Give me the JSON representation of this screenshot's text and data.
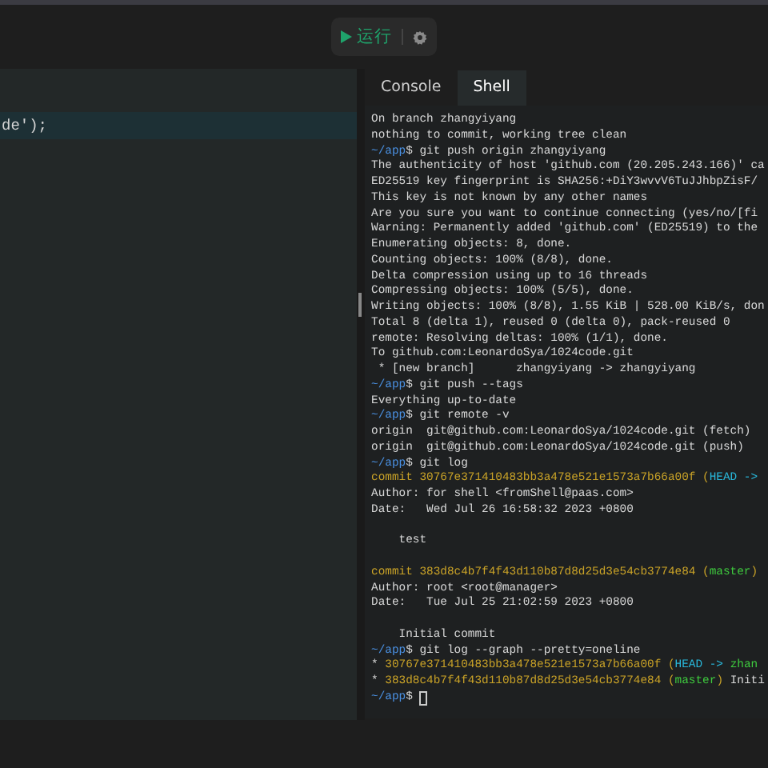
{
  "toolbar": {
    "run_button": {
      "label": "运行"
    }
  },
  "editor": {
    "code_line": {
      "text": "de');",
      "highlighted": true
    }
  },
  "terminal": {
    "tabs": [
      {
        "label": "Console",
        "selected": false
      },
      {
        "label": "Shell",
        "selected": true
      }
    ],
    "lines": [
      {
        "kind": "text",
        "segments": [
          {
            "kind": "plain",
            "text": "On branch zhangyiyang"
          }
        ]
      },
      {
        "kind": "text",
        "segments": [
          {
            "kind": "plain",
            "text": "nothing to commit, working tree clean"
          }
        ]
      },
      {
        "kind": "text",
        "segments": [
          {
            "kind": "prompt",
            "text": "~/app"
          },
          {
            "kind": "plain",
            "text": "$ git push origin zhangyiyang"
          }
        ]
      },
      {
        "kind": "text",
        "segments": [
          {
            "kind": "plain",
            "text": "The authenticity of host 'github.com (20.205.243.166)' ca"
          }
        ]
      },
      {
        "kind": "text",
        "segments": [
          {
            "kind": "plain",
            "text": "ED25519 key fingerprint is SHA256:+DiY3wvvV6TuJJhbpZisF/"
          }
        ]
      },
      {
        "kind": "text",
        "segments": [
          {
            "kind": "plain",
            "text": "This key is not known by any other names"
          }
        ]
      },
      {
        "kind": "text",
        "segments": [
          {
            "kind": "plain",
            "text": "Are you sure you want to continue connecting (yes/no/[fi"
          }
        ]
      },
      {
        "kind": "text",
        "segments": [
          {
            "kind": "plain",
            "text": "Warning: Permanently added 'github.com' (ED25519) to the"
          }
        ]
      },
      {
        "kind": "text",
        "segments": [
          {
            "kind": "plain",
            "text": "Enumerating objects: 8, done."
          }
        ]
      },
      {
        "kind": "text",
        "segments": [
          {
            "kind": "plain",
            "text": "Counting objects: 100% (8/8), done."
          }
        ]
      },
      {
        "kind": "text",
        "segments": [
          {
            "kind": "plain",
            "text": "Delta compression using up to 16 threads"
          }
        ]
      },
      {
        "kind": "text",
        "segments": [
          {
            "kind": "plain",
            "text": "Compressing objects: 100% (5/5), done."
          }
        ]
      },
      {
        "kind": "text",
        "segments": [
          {
            "kind": "plain",
            "text": "Writing objects: 100% (8/8), 1.55 KiB | 528.00 KiB/s, don"
          }
        ]
      },
      {
        "kind": "text",
        "segments": [
          {
            "kind": "plain",
            "text": "Total 8 (delta 1), reused 0 (delta 0), pack-reused 0"
          }
        ]
      },
      {
        "kind": "text",
        "segments": [
          {
            "kind": "plain",
            "text": "remote: Resolving deltas: 100% (1/1), done."
          }
        ]
      },
      {
        "kind": "text",
        "segments": [
          {
            "kind": "plain",
            "text": "To github.com:LeonardoSya/1024code.git"
          }
        ]
      },
      {
        "kind": "text",
        "segments": [
          {
            "kind": "plain",
            "text": " * [new branch]      zhangyiyang -> zhangyiyang"
          }
        ]
      },
      {
        "kind": "text",
        "segments": [
          {
            "kind": "prompt",
            "text": "~/app"
          },
          {
            "kind": "plain",
            "text": "$ git push --tags"
          }
        ]
      },
      {
        "kind": "text",
        "segments": [
          {
            "kind": "plain",
            "text": "Everything up-to-date"
          }
        ]
      },
      {
        "kind": "text",
        "segments": [
          {
            "kind": "prompt",
            "text": "~/app"
          },
          {
            "kind": "plain",
            "text": "$ git remote -v"
          }
        ]
      },
      {
        "kind": "text",
        "segments": [
          {
            "kind": "plain",
            "text": "origin  git@github.com:LeonardoSya/1024code.git (fetch)"
          }
        ]
      },
      {
        "kind": "text",
        "segments": [
          {
            "kind": "plain",
            "text": "origin  git@github.com:LeonardoSya/1024code.git (push)"
          }
        ]
      },
      {
        "kind": "text",
        "segments": [
          {
            "kind": "prompt",
            "text": "~/app"
          },
          {
            "kind": "plain",
            "text": "$ git log"
          }
        ]
      },
      {
        "kind": "text",
        "segments": [
          {
            "kind": "hash",
            "text": "commit 30767e371410483bb3a478e521e1573a7b66a00f ("
          },
          {
            "kind": "head",
            "text": "HEAD ->"
          }
        ]
      },
      {
        "kind": "text",
        "segments": [
          {
            "kind": "plain",
            "text": "Author: for shell <fromShell@paas.com>"
          }
        ]
      },
      {
        "kind": "text",
        "segments": [
          {
            "kind": "plain",
            "text": "Date:   Wed Jul 26 16:58:32 2023 +0800"
          }
        ]
      },
      {
        "kind": "blank"
      },
      {
        "kind": "text",
        "segments": [
          {
            "kind": "plain",
            "text": "    test"
          }
        ]
      },
      {
        "kind": "blank"
      },
      {
        "kind": "text",
        "segments": [
          {
            "kind": "hash",
            "text": "commit 383d8c4b7f4f43d110b87d8d25d3e54cb3774e84 ("
          },
          {
            "kind": "branch",
            "text": "master"
          },
          {
            "kind": "hash",
            "text": ")"
          }
        ]
      },
      {
        "kind": "text",
        "segments": [
          {
            "kind": "plain",
            "text": "Author: root <root@manager>"
          }
        ]
      },
      {
        "kind": "text",
        "segments": [
          {
            "kind": "plain",
            "text": "Date:   Tue Jul 25 21:02:59 2023 +0800"
          }
        ]
      },
      {
        "kind": "blank"
      },
      {
        "kind": "text",
        "segments": [
          {
            "kind": "plain",
            "text": "    Initial commit"
          }
        ]
      },
      {
        "kind": "text",
        "segments": [
          {
            "kind": "prompt",
            "text": "~/app"
          },
          {
            "kind": "plain",
            "text": "$ git log --graph --pretty=oneline"
          }
        ]
      },
      {
        "kind": "text",
        "segments": [
          {
            "kind": "plain",
            "text": "* "
          },
          {
            "kind": "hash",
            "text": "30767e371410483bb3a478e521e1573a7b66a00f ("
          },
          {
            "kind": "head",
            "text": "HEAD -> "
          },
          {
            "kind": "branch",
            "text": "zhan"
          }
        ]
      },
      {
        "kind": "text",
        "segments": [
          {
            "kind": "plain",
            "text": "* "
          },
          {
            "kind": "hash",
            "text": "383d8c4b7f4f43d110b87d8d25d3e54cb3774e84 ("
          },
          {
            "kind": "branch",
            "text": "master"
          },
          {
            "kind": "hash",
            "text": ")"
          },
          {
            "kind": "plain",
            "text": " Initi"
          }
        ]
      },
      {
        "kind": "text",
        "cursor": true,
        "segments": [
          {
            "kind": "prompt",
            "text": "~/app"
          },
          {
            "kind": "plain",
            "text": "$"
          }
        ]
      }
    ]
  }
}
